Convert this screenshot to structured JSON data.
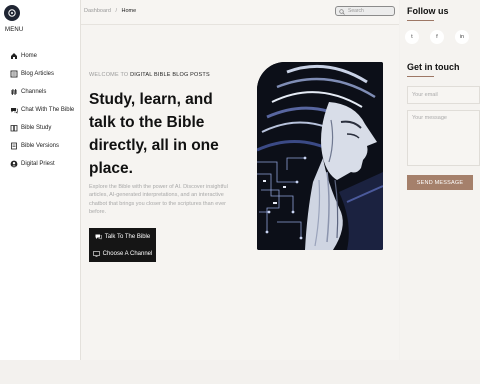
{
  "sidebar": {
    "menu_title": "MENU",
    "items": [
      {
        "label": "Home",
        "icon": "home-icon"
      },
      {
        "label": "Blog Articles",
        "icon": "article-icon"
      },
      {
        "label": "Channels",
        "icon": "hash-icon"
      },
      {
        "label": "Chat With The Bible",
        "icon": "chat-icon"
      },
      {
        "label": "Bible Study",
        "icon": "book-icon"
      },
      {
        "label": "Bible Versions",
        "icon": "versions-icon"
      },
      {
        "label": "Digital Priest",
        "icon": "user-icon"
      }
    ]
  },
  "header": {
    "breadcrumb_root": "Dashboard",
    "breadcrumb_sep": "/",
    "breadcrumb_current": "Home",
    "search_placeholder": "Search"
  },
  "hero": {
    "welcome_prefix": "WELCOME TO",
    "welcome_highlight": "DIGITAL BIBLE BLOG POSTS",
    "headline": "Study, learn, and talk to the Bible directly, all in one place.",
    "description": "Explore the Bible with the power of AI. Discover insightful articles, AI-generated interpretations, and an interactive chatbot that brings you closer to the scriptures than ever before.",
    "btn_talk": "Talk To The Bible",
    "btn_channel": "Choose A Channel"
  },
  "right": {
    "follow_title": "Follow us",
    "socials": [
      "t",
      "f",
      "in"
    ],
    "contact_title": "Get in touch",
    "email_placeholder": "Your email",
    "message_placeholder": "Your message",
    "send_label": "SEND MESSAGE"
  },
  "colors": {
    "accent": "#a5806b",
    "dark_button": "#151515",
    "page_bg": "#f3f1ee"
  }
}
